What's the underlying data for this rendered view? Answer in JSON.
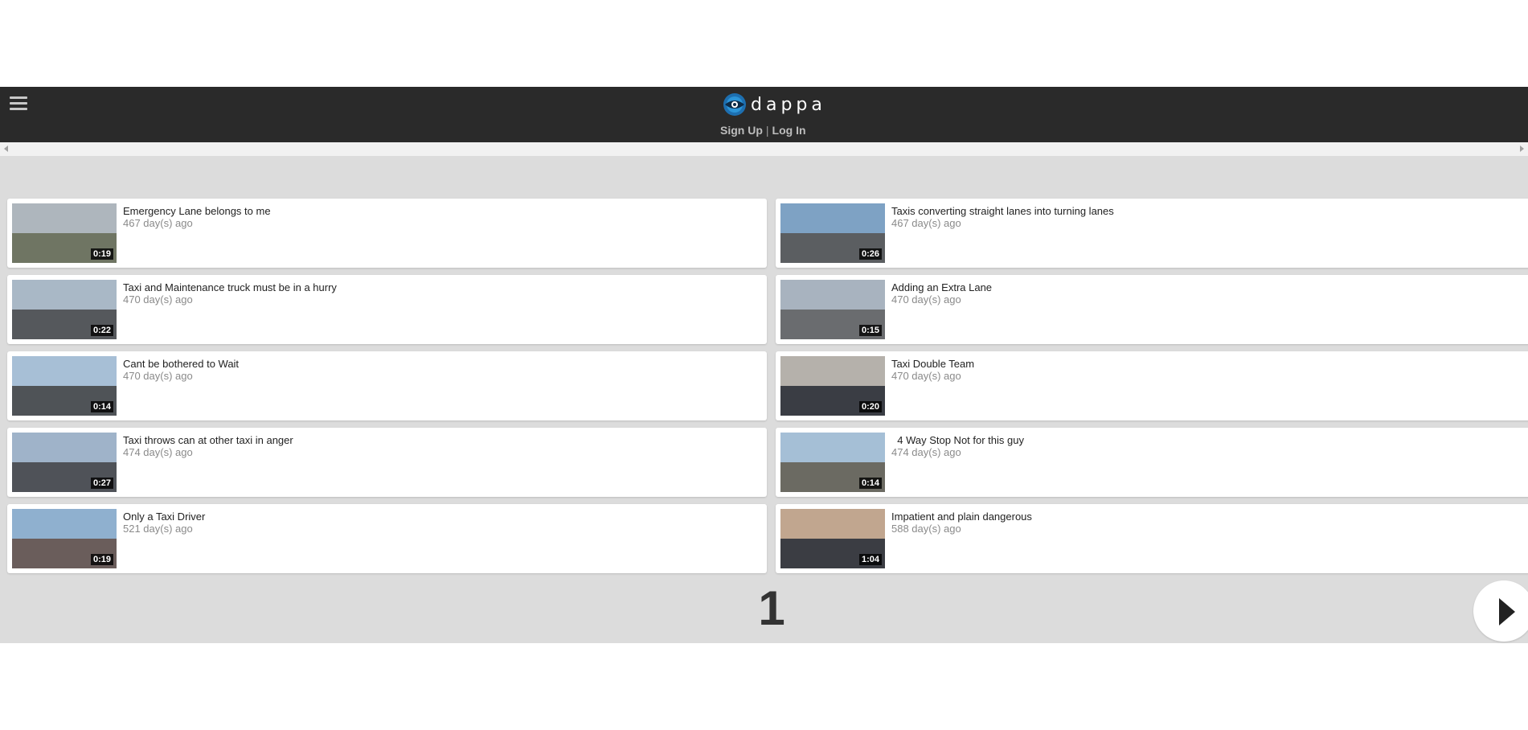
{
  "header": {
    "logo_text": "dappa",
    "sign_up": "Sign Up",
    "separator": "|",
    "log_in": "Log In"
  },
  "videos": [
    {
      "title": "Emergency Lane belongs to me",
      "age": "467 day(s) ago",
      "duration": "0:19",
      "sky": "#aeb6bd",
      "road": "#6f7563"
    },
    {
      "title": "Taxis converting straight lanes into turning lanes",
      "age": "467 day(s) ago",
      "duration": "0:26",
      "sky": "#7ea2c4",
      "road": "#5b5e61"
    },
    {
      "title": "Taxi and Maintenance truck must be in a hurry",
      "age": "470 day(s) ago",
      "duration": "0:22",
      "sky": "#a9b8c6",
      "road": "#55585c"
    },
    {
      "title": "Adding an Extra Lane",
      "age": "470 day(s) ago",
      "duration": "0:15",
      "sky": "#a8b3bf",
      "road": "#6a6c6f"
    },
    {
      "title": "Cant be bothered to Wait",
      "age": "470 day(s) ago",
      "duration": "0:14",
      "sky": "#a7bfd6",
      "road": "#4f5357"
    },
    {
      "title": "Taxi Double Team",
      "age": "470 day(s) ago",
      "duration": "0:20",
      "sky": "#b5b1ab",
      "road": "#3a3d44"
    },
    {
      "title": "Taxi throws can at other taxi in anger",
      "age": "474 day(s) ago",
      "duration": "0:27",
      "sky": "#9fb3c9",
      "road": "#4f5258"
    },
    {
      "title": "  4 Way Stop Not for this guy",
      "age": "474 day(s) ago",
      "duration": "0:14",
      "sky": "#a5bfd6",
      "road": "#6b6a62"
    },
    {
      "title": "Only a Taxi Driver",
      "age": "521 day(s) ago",
      "duration": "0:19",
      "sky": "#8fb0cf",
      "road": "#6a5d5b"
    },
    {
      "title": "Impatient and plain dangerous",
      "age": "588 day(s) ago",
      "duration": "1:04",
      "sky": "#c1a68f",
      "road": "#3b3d43"
    }
  ],
  "pagination": {
    "current_page": "1"
  }
}
